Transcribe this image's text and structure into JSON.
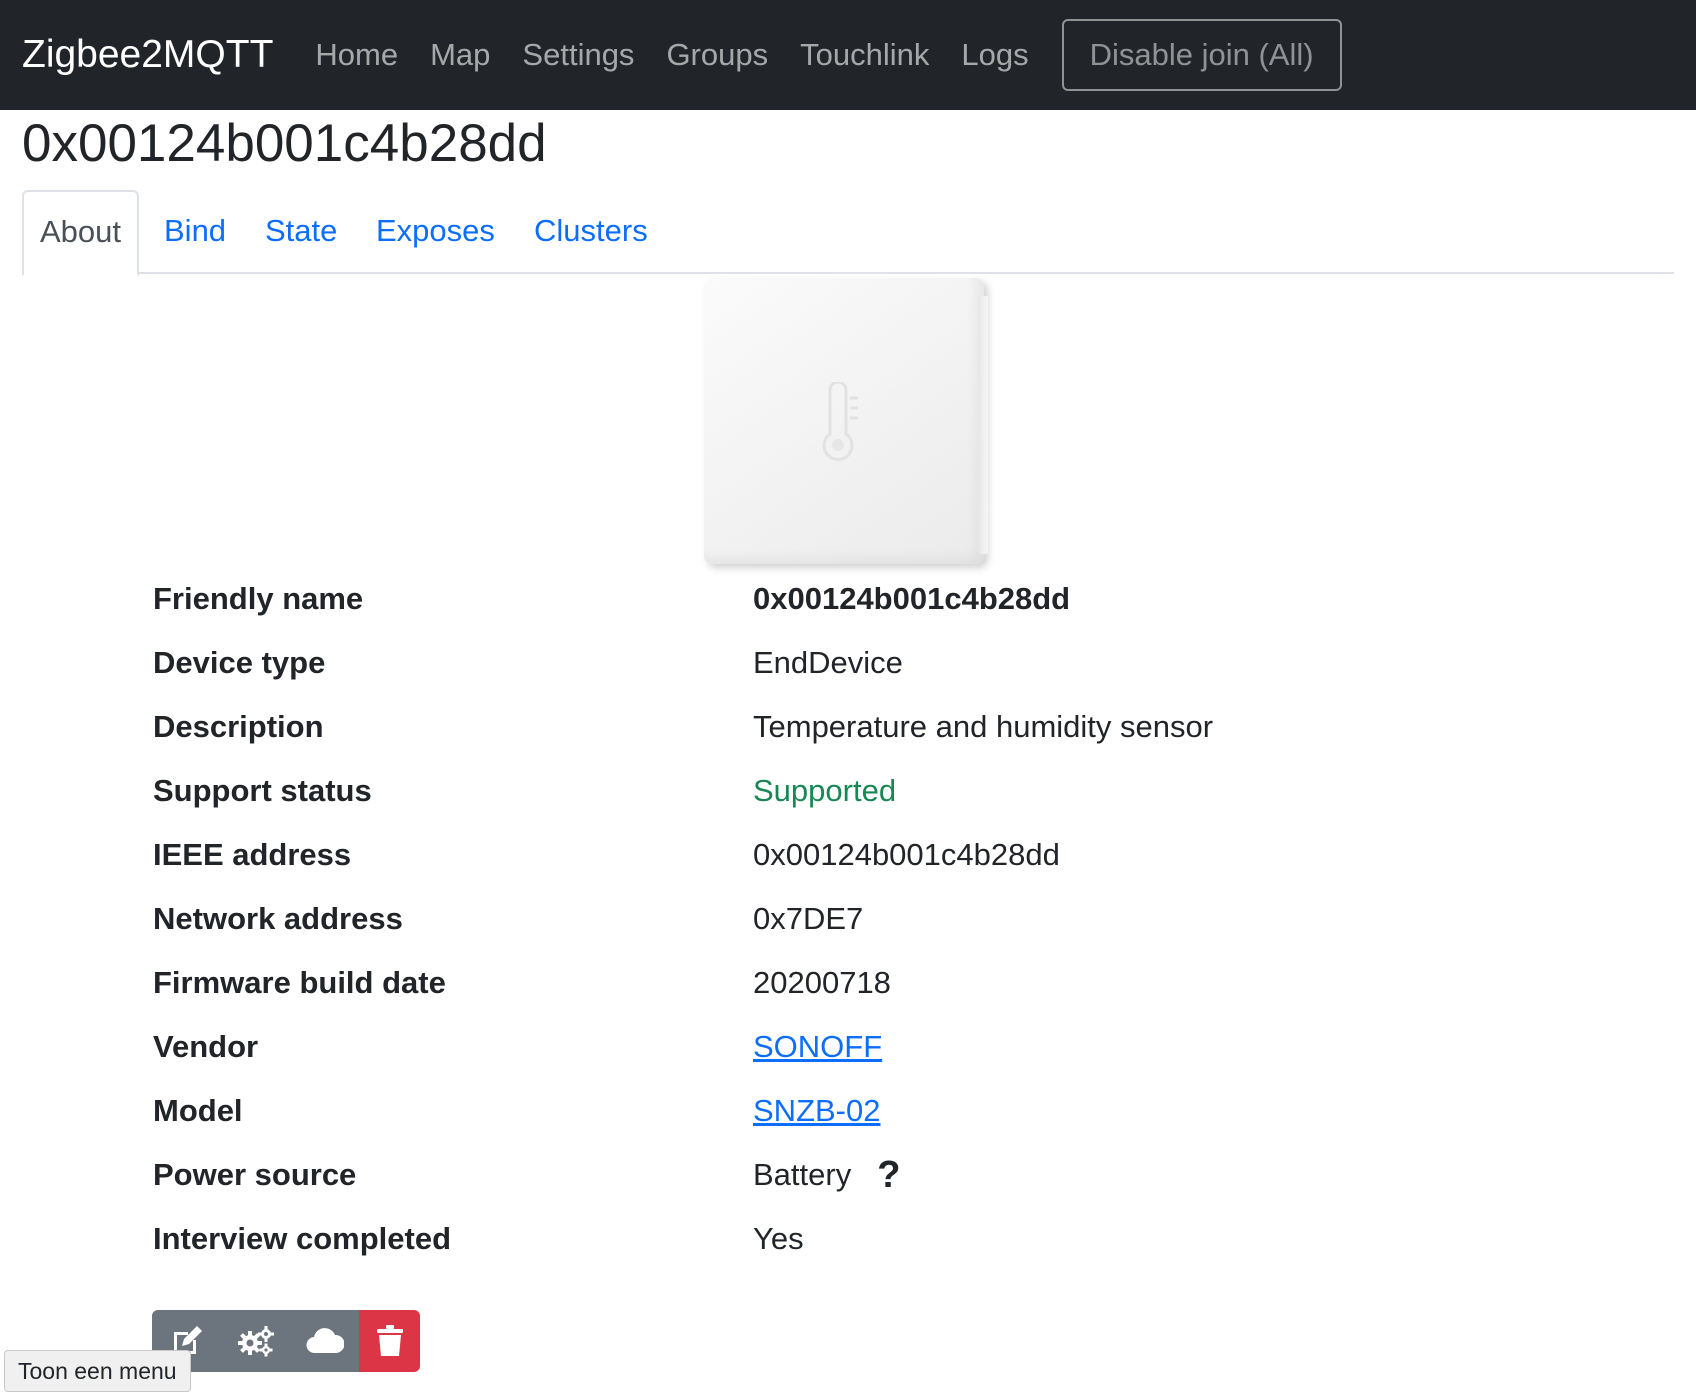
{
  "navbar": {
    "brand": "Zigbee2MQTT",
    "links": [
      "Home",
      "Map",
      "Settings",
      "Groups",
      "Touchlink",
      "Logs"
    ],
    "join_button": "Disable join (All)"
  },
  "page_title": "0x00124b001c4b28dd",
  "tabs": [
    "About",
    "Bind",
    "State",
    "Exposes",
    "Clusters"
  ],
  "active_tab": "About",
  "device_image": {
    "icon": "thermometer-icon"
  },
  "device_info": {
    "friendly_name": {
      "label": "Friendly name",
      "value": "0x00124b001c4b28dd"
    },
    "device_type": {
      "label": "Device type",
      "value": "EndDevice"
    },
    "description": {
      "label": "Description",
      "value": "Temperature and humidity sensor"
    },
    "support_status": {
      "label": "Support status",
      "value": "Supported"
    },
    "ieee_address": {
      "label": "IEEE address",
      "value": "0x00124b001c4b28dd"
    },
    "network_address": {
      "label": "Network address",
      "value": "0x7DE7"
    },
    "firmware_build_date": {
      "label": "Firmware build date",
      "value": "20200718"
    },
    "vendor": {
      "label": "Vendor",
      "value": "SONOFF"
    },
    "model": {
      "label": "Model",
      "value": "SNZB-02"
    },
    "power_source": {
      "label": "Power source",
      "value": "Battery",
      "help": "?"
    },
    "interview_completed": {
      "label": "Interview completed",
      "value": "Yes"
    }
  },
  "actions": {
    "icons": [
      "edit-icon",
      "gears-icon",
      "cloud-icon",
      "trash-icon"
    ]
  },
  "tooltip": {
    "text": "Toon een menu"
  },
  "colors": {
    "navbar_bg": "#212529",
    "link": "#0d6efd",
    "success": "#198754",
    "secondary": "#6c757d",
    "danger": "#dc3545"
  }
}
